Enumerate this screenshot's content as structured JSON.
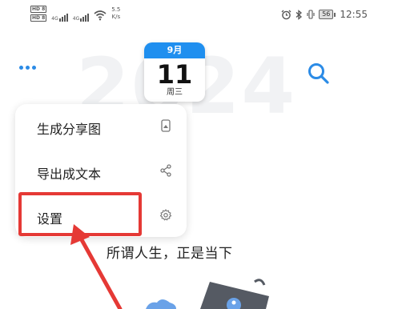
{
  "status_bar": {
    "hd_top": "HD",
    "hd_top_num": "8",
    "hd_bottom": "HD",
    "hd_bottom_num": "8",
    "sim1": "4G",
    "sim2": "4G",
    "speed_value": "5.5",
    "speed_unit": "K/s",
    "battery": "56",
    "time": "12:55"
  },
  "header": {
    "year_watermark": "2024",
    "calendar_month": "9月",
    "calendar_day": "11",
    "calendar_weekday": "周三"
  },
  "menu": {
    "items": [
      {
        "label": "生成分享图",
        "icon": "share-image-icon"
      },
      {
        "label": "导出成文本",
        "icon": "share-icon"
      },
      {
        "label": "设置",
        "icon": "gear-icon"
      }
    ]
  },
  "quote": "所谓人生，正是当下",
  "colors": {
    "accent": "#2b8be6",
    "highlight": "#e53935",
    "calendar_header": "#1f8fef"
  }
}
